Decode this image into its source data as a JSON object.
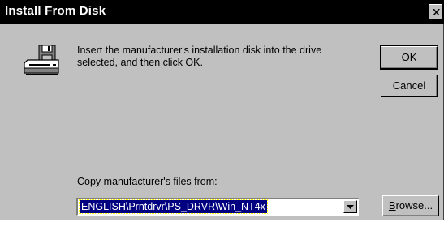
{
  "window": {
    "title": "Install From Disk",
    "close_icon": "close-x-icon"
  },
  "icon": {
    "name": "disk-drive-icon"
  },
  "message": "Insert the manufacturer's installation disk into the drive selected, and then click OK.",
  "buttons": {
    "ok": "OK",
    "cancel": "Cancel",
    "browse_mnemonic": "B",
    "browse_rest": "rowse..."
  },
  "copy_from": {
    "label_mnemonic": "C",
    "label_rest": "opy manufacturer's files from:",
    "value": "ENGLISH\\Prntdrvr\\PS_DRVR\\Win_NT4x",
    "dropdown_icon": "chevron-down-icon"
  },
  "colors": {
    "face": "#c0c0c0",
    "titlebar": "#000000",
    "selection": "#000080"
  }
}
